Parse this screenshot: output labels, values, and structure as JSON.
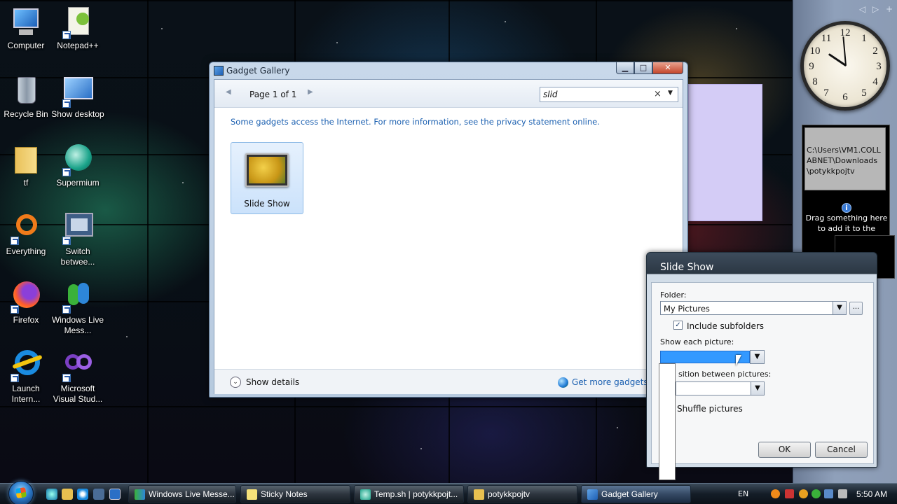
{
  "desktop": {
    "icons": [
      {
        "label": "Computer"
      },
      {
        "label": "Notepad++"
      },
      {
        "label": "Recycle Bin"
      },
      {
        "label": "Show desktop"
      },
      {
        "label": "tf"
      },
      {
        "label": "Supermium"
      },
      {
        "label": "Everything"
      },
      {
        "label": "Switch betwee..."
      },
      {
        "label": "Firefox"
      },
      {
        "label": "Windows Live Mess..."
      },
      {
        "label": "Launch Intern..."
      },
      {
        "label": "Microsoft Visual Stud..."
      }
    ]
  },
  "gallery": {
    "title": "Gadget Gallery",
    "page_label": "Page 1 of 1",
    "search_value": "slid",
    "privacy_text": "Some gadgets access the Internet.  For more information, see the privacy statement online.",
    "gadget_label": "Slide Show",
    "show_details": "Show details",
    "get_more": "Get more gadgets o"
  },
  "sidebar": {
    "clock_numbers": [
      "12",
      "1",
      "2",
      "3",
      "4",
      "5",
      "6",
      "7",
      "8",
      "9",
      "10",
      "11"
    ],
    "slideshow_path": "C:\\Users\\VM1.COLLABNET\\Downloads\\potykkpojtv",
    "slideshow_info": "Drag something here to add it to the"
  },
  "settings": {
    "title": "Slide Show",
    "folder_label": "Folder:",
    "folder_value": "My Pictures",
    "include_subfolders": "Include subfolders",
    "show_each_label": "Show each picture:",
    "show_each_value": "",
    "transition_label": "sition between pictures:",
    "shuffle_label": "Shuffle pictures",
    "ok": "OK",
    "cancel": "Cancel"
  },
  "taskbar": {
    "buttons": [
      {
        "label": "Windows Live Messe..."
      },
      {
        "label": "Sticky Notes"
      },
      {
        "label": "Temp.sh | potykkpojt..."
      },
      {
        "label": "potykkpojtv"
      },
      {
        "label": "Gadget Gallery"
      }
    ],
    "language": "EN",
    "time": "5:50 AM"
  }
}
